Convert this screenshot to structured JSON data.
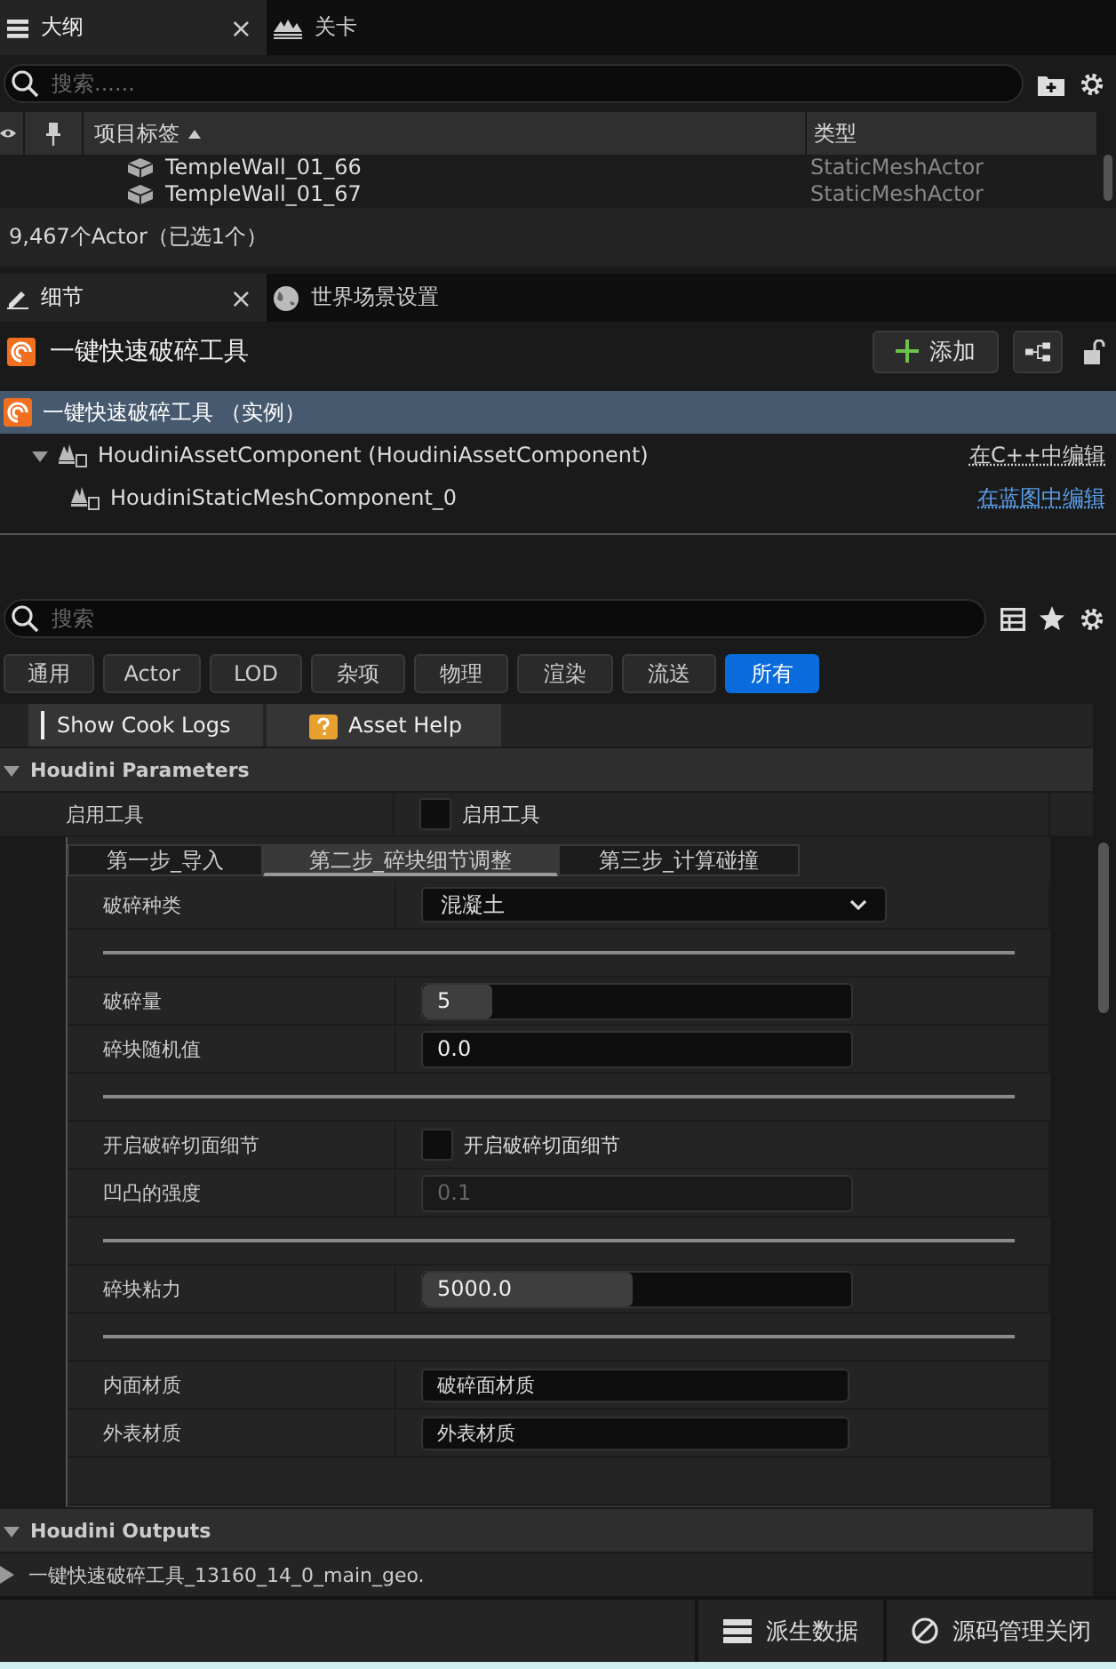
{
  "outliner": {
    "tabs": [
      {
        "label": "大纲",
        "selected": true,
        "close": "×"
      },
      {
        "label": "关卡",
        "selected": false
      }
    ],
    "search": {
      "placeholder": "搜索......"
    },
    "columns": [
      "项目标签",
      "类型"
    ],
    "rows": [
      {
        "label": "TempleWall_01_66",
        "type": "StaticMeshActor"
      },
      {
        "label": "TempleWall_01_67",
        "type": "StaticMeshActor"
      }
    ],
    "status": "9,467个Actor（已选1个）"
  },
  "details": {
    "tabs": [
      {
        "label": "细节",
        "selected": true,
        "close": "×"
      },
      {
        "label": "世界场景设置",
        "selected": false
      }
    ],
    "title": "一键快速破碎工具",
    "add_button": "添加",
    "components": [
      {
        "label": "一键快速破碎工具 （实例）",
        "selected": true,
        "children": [
          {
            "label": "HoudiniAssetComponent (HoudiniAssetComponent)",
            "selected": false,
            "expanded": true,
            "link": "在C++中编辑",
            "children": [
              {
                "label": "HoudiniStaticMeshComponent_0",
                "selected": false,
                "link": "在蓝图中编辑"
              }
            ]
          }
        ]
      }
    ],
    "search": {
      "placeholder": "搜索"
    },
    "filters": [
      {
        "label": "通用",
        "selected": false
      },
      {
        "label": "Actor",
        "selected": false
      },
      {
        "label": "LOD",
        "selected": false
      },
      {
        "label": "杂项",
        "selected": false
      },
      {
        "label": "物理",
        "selected": false
      },
      {
        "label": "渲染",
        "selected": false
      },
      {
        "label": "流送",
        "selected": false
      },
      {
        "label": "所有",
        "selected": true
      }
    ],
    "actions": [
      {
        "label": "Show Cook Logs"
      },
      {
        "label": "Asset Help"
      }
    ],
    "parameters": {
      "title": "Houdini Parameters",
      "expanded": true,
      "toggle": {
        "label": "启用工具",
        "caption": "启用工具",
        "checked": false
      },
      "steps": [
        {
          "label": "第一步_导入",
          "selected": false
        },
        {
          "label": "第二步_碎块细节调整",
          "selected": true
        },
        {
          "label": "第三步_计算碰撞",
          "selected": false
        }
      ],
      "rows": [
        {
          "kind": "dropdown",
          "label": "破碎种类",
          "value": "混凝土"
        },
        {
          "kind": "separator"
        },
        {
          "kind": "number",
          "label": "破碎量",
          "value": "5",
          "level": 0.16,
          "disabled": false
        },
        {
          "kind": "number",
          "label": "碎块随机值",
          "value": "0.0",
          "disabled": false
        },
        {
          "kind": "separator"
        },
        {
          "kind": "checkbox",
          "label": "开启破碎切面细节",
          "caption": "开启破碎切面细节",
          "checked": false
        },
        {
          "kind": "number",
          "label": "凹凸的强度",
          "value": "0.1",
          "disabled": true
        },
        {
          "kind": "separator"
        },
        {
          "kind": "number",
          "label": "碎块粘力",
          "value": "5000.0",
          "level": 0.49,
          "disabled": false
        },
        {
          "kind": "separator"
        },
        {
          "kind": "text",
          "label": "内面材质",
          "value": "破碎面材质"
        },
        {
          "kind": "text",
          "label": "外表材质",
          "value": "外表材质"
        }
      ]
    },
    "outputs": {
      "title": "Houdini Outputs",
      "expanded": true,
      "items": [
        {
          "label": "一键快速破碎工具_13160_14_0_main_geo.",
          "expanded": false
        }
      ]
    }
  },
  "status_bar": [
    {
      "label": "派生数据"
    },
    {
      "label": "源码管理关闭"
    }
  ]
}
